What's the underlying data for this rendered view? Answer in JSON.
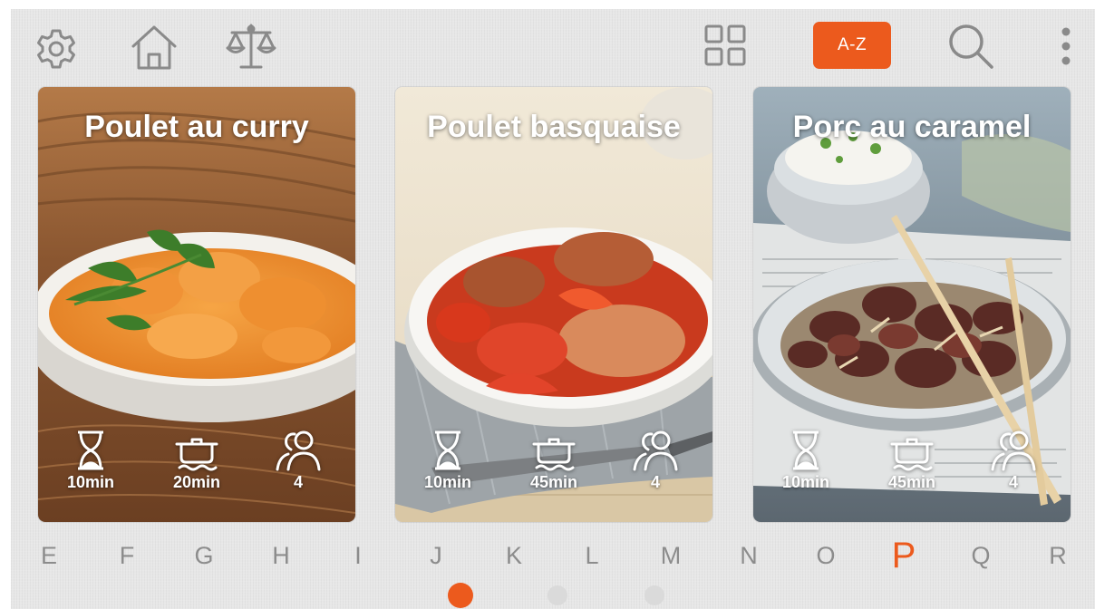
{
  "toolbar": {
    "left_icons": [
      "gear-icon",
      "home-icon",
      "scale-icon"
    ],
    "right_icons": [
      "grid-view-icon",
      "search-icon",
      "more-vertical-icon"
    ],
    "sort_button_label": "A-Z",
    "accent_color": "#ec5a1d",
    "icon_color": "#8a8a8a"
  },
  "recipes": [
    {
      "title": "Poulet au curry",
      "prep_time": "10min",
      "cook_time": "20min",
      "servings": "4"
    },
    {
      "title": "Poulet basquaise",
      "prep_time": "10min",
      "cook_time": "45min",
      "servings": "4"
    },
    {
      "title": "Porc au caramel",
      "prep_time": "10min",
      "cook_time": "45min",
      "servings": "4"
    }
  ],
  "meta_icons": [
    "hourglass-icon",
    "cooking-pot-icon",
    "people-icon"
  ],
  "alphabet": {
    "letters": [
      "E",
      "F",
      "G",
      "H",
      "I",
      "J",
      "K",
      "L",
      "M",
      "N",
      "O",
      "P",
      "Q",
      "R"
    ],
    "active": "P"
  },
  "pagination": {
    "pages": 3,
    "active_page": 1
  }
}
